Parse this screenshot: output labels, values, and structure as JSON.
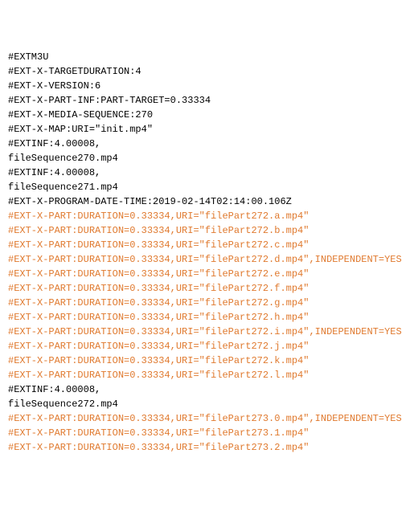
{
  "lines": [
    {
      "text": "#EXTM3U",
      "color": "black"
    },
    {
      "text": "#EXT-X-TARGETDURATION:4",
      "color": "black"
    },
    {
      "text": "#EXT-X-VERSION:6",
      "color": "black"
    },
    {
      "text": "#EXT-X-PART-INF:PART-TARGET=0.33334",
      "color": "black"
    },
    {
      "text": "#EXT-X-MEDIA-SEQUENCE:270",
      "color": "black"
    },
    {
      "text": "#EXT-X-MAP:URI=\"init.mp4\"",
      "color": "black"
    },
    {
      "text": "",
      "color": "black"
    },
    {
      "text": "#EXTINF:4.00008,",
      "color": "black"
    },
    {
      "text": "fileSequence270.mp4",
      "color": "black"
    },
    {
      "text": "#EXTINF:4.00008,",
      "color": "black"
    },
    {
      "text": "fileSequence271.mp4",
      "color": "black"
    },
    {
      "text": "#EXT-X-PROGRAM-DATE-TIME:2019-02-14T02:14:00.106Z",
      "color": "black"
    },
    {
      "text": "#EXT-X-PART:DURATION=0.33334,URI=\"filePart272.a.mp4\"",
      "color": "orange"
    },
    {
      "text": "#EXT-X-PART:DURATION=0.33334,URI=\"filePart272.b.mp4\"",
      "color": "orange"
    },
    {
      "text": "#EXT-X-PART:DURATION=0.33334,URI=\"filePart272.c.mp4\"",
      "color": "orange"
    },
    {
      "text": "#EXT-X-PART:DURATION=0.33334,URI=\"filePart272.d.mp4\",INDEPENDENT=YES",
      "color": "orange"
    },
    {
      "text": "#EXT-X-PART:DURATION=0.33334,URI=\"filePart272.e.mp4\"",
      "color": "orange"
    },
    {
      "text": "#EXT-X-PART:DURATION=0.33334,URI=\"filePart272.f.mp4\"",
      "color": "orange"
    },
    {
      "text": "#EXT-X-PART:DURATION=0.33334,URI=\"filePart272.g.mp4\"",
      "color": "orange"
    },
    {
      "text": "#EXT-X-PART:DURATION=0.33334,URI=\"filePart272.h.mp4\"",
      "color": "orange"
    },
    {
      "text": "#EXT-X-PART:DURATION=0.33334,URI=\"filePart272.i.mp4\",INDEPENDENT=YES",
      "color": "orange"
    },
    {
      "text": "#EXT-X-PART:DURATION=0.33334,URI=\"filePart272.j.mp4\"",
      "color": "orange"
    },
    {
      "text": "#EXT-X-PART:DURATION=0.33334,URI=\"filePart272.k.mp4\"",
      "color": "orange"
    },
    {
      "text": "#EXT-X-PART:DURATION=0.33334,URI=\"filePart272.l.mp4\"",
      "color": "orange"
    },
    {
      "text": "#EXTINF:4.00008,",
      "color": "black"
    },
    {
      "text": "fileSequence272.mp4",
      "color": "black"
    },
    {
      "text": "#EXT-X-PART:DURATION=0.33334,URI=\"filePart273.0.mp4\",INDEPENDENT=YES",
      "color": "orange"
    },
    {
      "text": "#EXT-X-PART:DURATION=0.33334,URI=\"filePart273.1.mp4\"",
      "color": "orange"
    },
    {
      "text": "#EXT-X-PART:DURATION=0.33334,URI=\"filePart273.2.mp4\"",
      "color": "orange"
    }
  ]
}
